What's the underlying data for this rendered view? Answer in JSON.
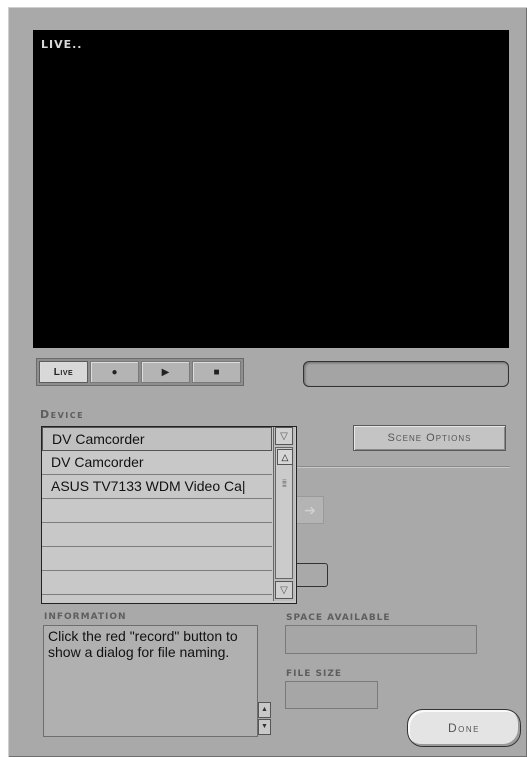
{
  "preview": {
    "status_label": "LIVE.."
  },
  "transport": {
    "live_label": "Live",
    "record_glyph": "●",
    "play_glyph": "▶",
    "stop_glyph": "■"
  },
  "device": {
    "label": "Device",
    "selected": "DV Camcorder",
    "options": [
      "DV Camcorder",
      "ASUS TV7133 WDM Video Ca|",
      "",
      "",
      "",
      ""
    ]
  },
  "scene_options_label": "Scene Options",
  "information": {
    "label": "INFORMATION",
    "text": "Click the red \"record\" button to show a dialog for file naming."
  },
  "space_available": {
    "label": "SPACE AVAILABLE",
    "value": ""
  },
  "file_size": {
    "label": "FILE SIZE",
    "value": ""
  },
  "done_label": "Done",
  "icons": [
    "chevron-down-icon",
    "chevron-up-icon",
    "record-icon",
    "play-icon",
    "stop-icon",
    "arrow-right-icon"
  ]
}
